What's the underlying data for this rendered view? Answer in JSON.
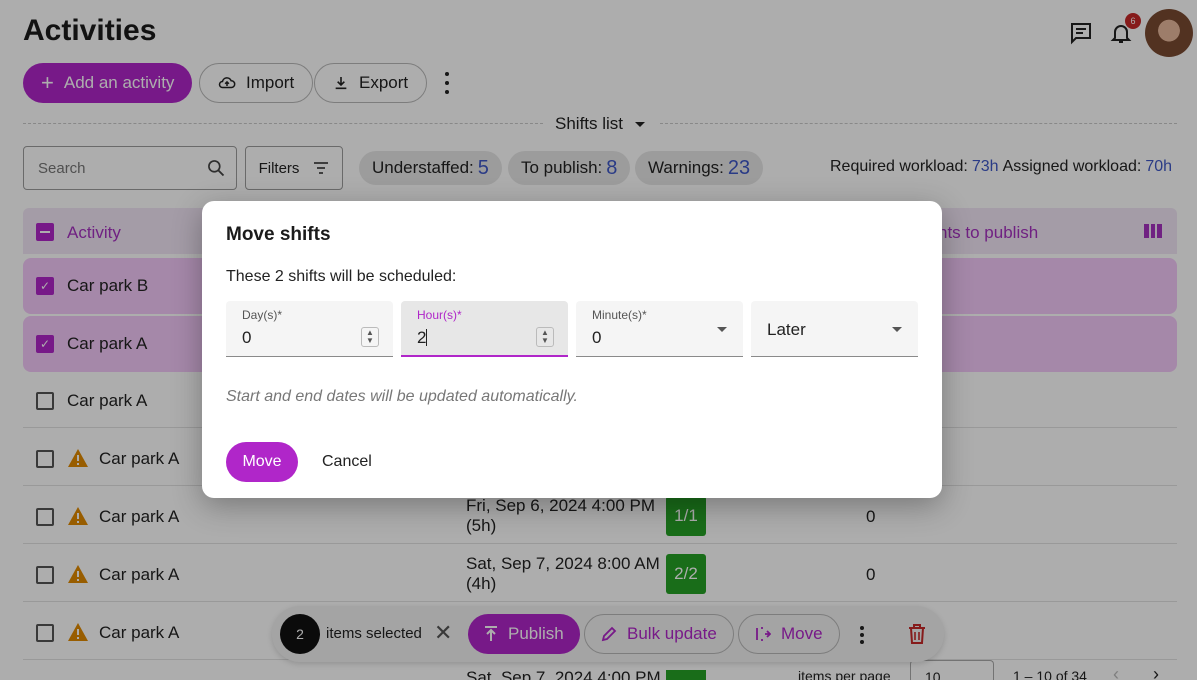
{
  "header": {
    "title": "Activities",
    "notifications_count": "6"
  },
  "toolbar": {
    "add_label": "Add an activity",
    "import_label": "Import",
    "export_label": "Export"
  },
  "view_selector": {
    "label": "Shifts list"
  },
  "filters": {
    "search_placeholder": "Search",
    "filters_label": "Filters"
  },
  "stats": {
    "understaffed_label": "Understaffed:",
    "understaffed_value": "5",
    "to_publish_label": "To publish:",
    "to_publish_value": "8",
    "warnings_label": "Warnings:",
    "warnings_value": "23",
    "required_label": "Required workload:",
    "required_value": "73h",
    "assigned_label": "Assigned workload:",
    "assigned_value": "70h"
  },
  "table": {
    "col_activity": "Activity",
    "col_publish": "nts to publish",
    "rows": [
      {
        "activity": "Car park B",
        "selected": true,
        "warning": false
      },
      {
        "activity": "Car park A",
        "selected": true,
        "warning": false
      },
      {
        "activity": "Car park A",
        "selected": false,
        "warning": false
      },
      {
        "activity": "Car park A",
        "selected": false,
        "warning": true
      },
      {
        "activity": "Car park A",
        "selected": false,
        "warning": true,
        "date": "Fri, Sep 6, 2024 4:00 PM",
        "duration": "(5h)",
        "staff": "1/1",
        "publish": "0"
      },
      {
        "activity": "Car park A",
        "selected": false,
        "warning": true,
        "date": "Sat, Sep 7, 2024 8:00 AM",
        "duration": "(4h)",
        "staff": "2/2",
        "publish": "0"
      },
      {
        "activity": "Car park A",
        "selected": false,
        "warning": true
      }
    ],
    "partial_date": "Sat, Sep 7, 2024 4:00 PM"
  },
  "pagination": {
    "items_per_page_label": "items per page",
    "items_per_page_value": "10",
    "range": "1 – 10 of 34"
  },
  "action_bar": {
    "count": "2",
    "selected_label": "items selected",
    "publish_label": "Publish",
    "bulk_update_label": "Bulk update",
    "move_label": "Move"
  },
  "modal": {
    "title": "Move shifts",
    "subtitle": "These 2 shifts will be scheduled:",
    "days_label": "Day(s)*",
    "days_value": "0",
    "hours_label": "Hour(s)*",
    "hours_value": "2",
    "minutes_label": "Minute(s)*",
    "minutes_value": "0",
    "direction_value": "Later",
    "hint": "Start and end dates will be updated automatically.",
    "move_label": "Move",
    "cancel_label": "Cancel"
  },
  "colors": {
    "accent": "#b026c9",
    "link_number": "#3f58c6",
    "success": "#25a125",
    "warning": "#e08a00",
    "danger": "#c62828"
  }
}
